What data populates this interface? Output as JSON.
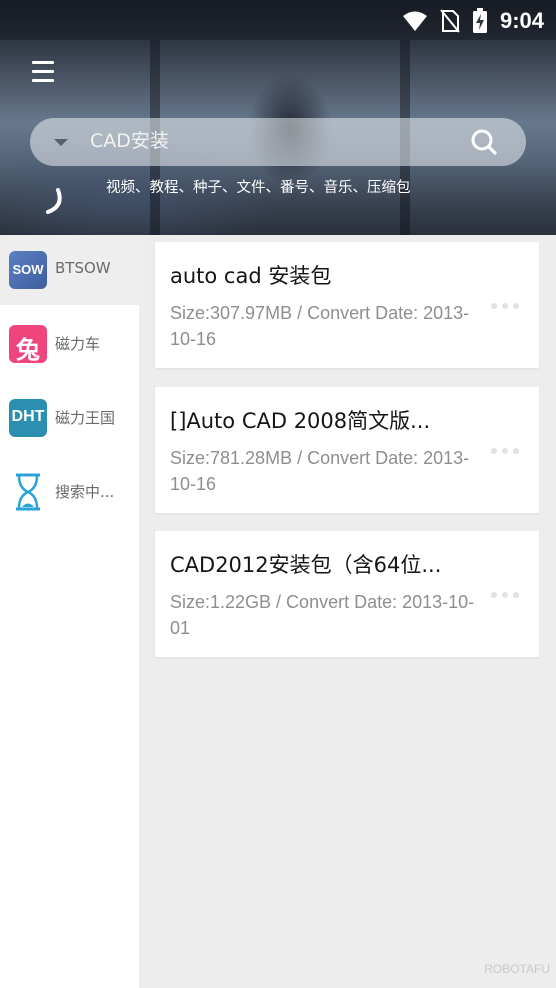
{
  "status_bar": {
    "time": "9:04",
    "icons": [
      "wifi-icon",
      "no-sim-icon",
      "battery-charging-icon"
    ]
  },
  "header": {
    "menu_icon": "hamburger-menu-icon",
    "search": {
      "value": "CAD安装",
      "icon": "search-icon",
      "dropdown_icon": "caret-down-icon"
    },
    "hint": "视频、教程、种子、文件、番号、音乐、压缩包"
  },
  "sidebar": {
    "items": [
      {
        "label": "BTSOW",
        "icon_text": "SOW",
        "icon": "btsow-logo-icon",
        "active": true
      },
      {
        "label": "磁力车",
        "icon_text": "兔",
        "icon": "rabbit-logo-icon",
        "active": false
      },
      {
        "label": "磁力王国",
        "icon_text": "DHT",
        "icon": "dht-logo-icon",
        "active": false
      },
      {
        "label": "搜索中...",
        "icon": "hourglass-icon",
        "active": false
      }
    ]
  },
  "results": [
    {
      "title": "auto cad 安装包",
      "meta": "Size:307.97MB / Convert Date: 2013-10-16"
    },
    {
      "title": "[]Auto CAD 2008简文版...",
      "meta": "Size:781.28MB / Convert Date: 2013-10-16"
    },
    {
      "title": "CAD2012安装包（含64位...",
      "meta": "Size:1.22GB / Convert Date: 2013-10-01"
    }
  ],
  "watermark": "ROBOTAFU",
  "colors": {
    "btsow_icon": "#4a6fb5",
    "rabbit_icon": "#f0447c",
    "dht_icon": "#2b8fb0",
    "hourglass": "#2aa2d8"
  }
}
